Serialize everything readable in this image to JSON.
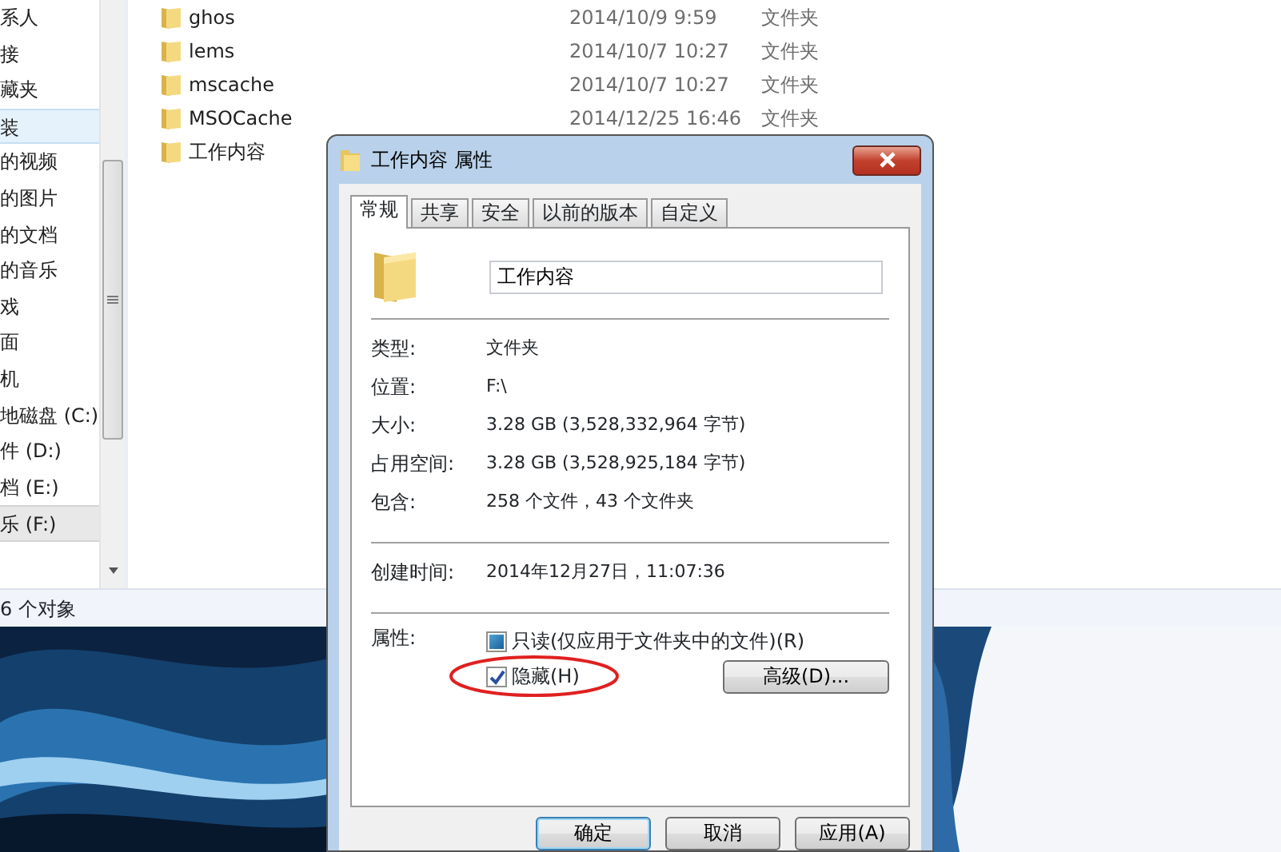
{
  "sidebar": {
    "items": [
      {
        "label": "系人",
        "selected": false,
        "hovered": false
      },
      {
        "label": "接",
        "selected": false,
        "hovered": false
      },
      {
        "label": "藏夹",
        "selected": false,
        "hovered": false
      },
      {
        "label": "装",
        "selected": false,
        "hovered": true
      },
      {
        "label": "的视频",
        "selected": false,
        "hovered": false
      },
      {
        "label": "的图片",
        "selected": false,
        "hovered": false
      },
      {
        "label": "的文档",
        "selected": false,
        "hovered": false
      },
      {
        "label": "的音乐",
        "selected": false,
        "hovered": false
      },
      {
        "label": "戏",
        "selected": false,
        "hovered": false
      },
      {
        "label": "面",
        "selected": false,
        "hovered": false
      },
      {
        "label": "机",
        "selected": false,
        "hovered": false
      },
      {
        "label": "地磁盘 (C:)",
        "selected": false,
        "hovered": false
      },
      {
        "label": "件 (D:)",
        "selected": false,
        "hovered": false
      },
      {
        "label": "档 (E:)",
        "selected": false,
        "hovered": false
      },
      {
        "label": "乐 (F:)",
        "selected": true,
        "hovered": false
      }
    ]
  },
  "files": [
    {
      "name": "ghos",
      "date": "2014/10/9 9:59",
      "type": "文件夹"
    },
    {
      "name": "lems",
      "date": "2014/10/7 10:27",
      "type": "文件夹"
    },
    {
      "name": "mscache",
      "date": "2014/10/7 10:27",
      "type": "文件夹"
    },
    {
      "name": "MSOCache",
      "date": "2014/12/25 16:46",
      "type": "文件夹"
    },
    {
      "name": "工作内容"
    }
  ],
  "status_bar": "6 个对象",
  "dialog": {
    "title": "工作内容 属性",
    "tabs": [
      {
        "label": "常规",
        "selected": true
      },
      {
        "label": "共享",
        "selected": false
      },
      {
        "label": "安全",
        "selected": false
      },
      {
        "label": "以前的版本",
        "selected": false
      },
      {
        "label": "自定义",
        "selected": false
      }
    ],
    "name_value": "工作内容",
    "groups": [
      [
        {
          "label": "类型:",
          "value": "文件夹"
        },
        {
          "label": "位置:",
          "value": "F:\\"
        },
        {
          "label": "大小:",
          "value": "3.28 GB (3,528,332,964 字节)"
        },
        {
          "label": "占用空间:",
          "value": "3.28 GB (3,528,925,184 字节)"
        },
        {
          "label": "包含:",
          "value": "258 个文件，43 个文件夹"
        }
      ],
      [
        {
          "label": "创建时间:",
          "value": "2014年12月27日，11:07:36"
        }
      ]
    ],
    "attributes_label": "属性:",
    "attributes": [
      {
        "label": "只读(仅应用于文件夹中的文件)(R)",
        "checked": false,
        "indeterminate": true,
        "circled": false
      },
      {
        "label": "隐藏(H)",
        "checked": true,
        "indeterminate": false,
        "circled": true
      }
    ],
    "advanced_button": "高级(D)...",
    "buttons": [
      {
        "label": "确定",
        "default": true
      },
      {
        "label": "取消",
        "default": false
      },
      {
        "label": "应用(A)",
        "default": false
      }
    ]
  }
}
